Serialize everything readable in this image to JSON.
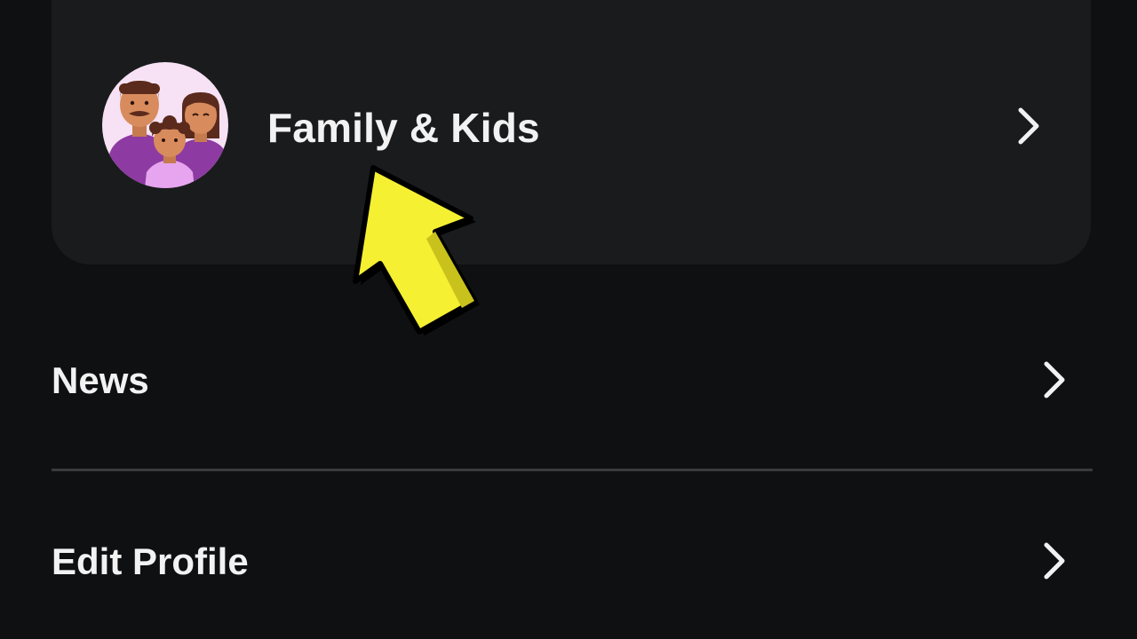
{
  "menu": {
    "card_item": {
      "label": "Family & Kids",
      "icon": "family-avatar-icon"
    },
    "items": [
      {
        "label": "News",
        "icon": "chevron-right-icon"
      },
      {
        "label": "Edit Profile",
        "icon": "chevron-right-icon"
      }
    ]
  },
  "overlay": {
    "pointer_icon": "yellow-arrow-pointer-icon"
  },
  "colors": {
    "background": "#0f1012",
    "card": "#1a1b1d",
    "text": "#f2f2f2",
    "divider": "#3a3b3e",
    "arrow": "#f5f032",
    "avatar_bg": "#f6e2f4",
    "avatar_purple": "#8e3aa3"
  }
}
